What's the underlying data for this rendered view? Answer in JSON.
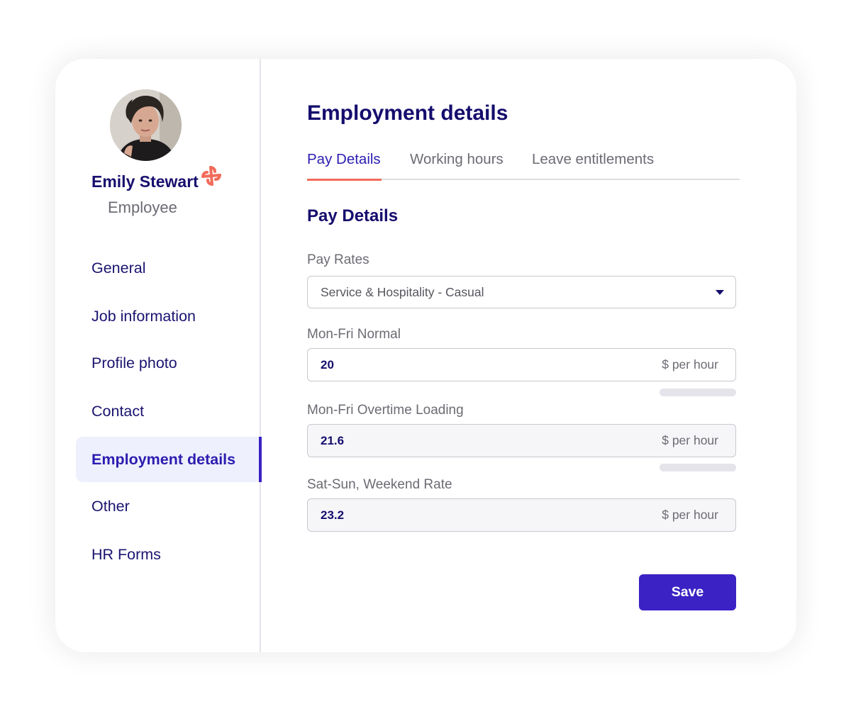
{
  "profile": {
    "name": "Emily Stewart",
    "role": "Employee",
    "avatar_icon": "person-photo"
  },
  "sidebar": {
    "items": [
      {
        "label": "General"
      },
      {
        "label": "Job information"
      },
      {
        "label": "Profile photo"
      },
      {
        "label": "Contact"
      },
      {
        "label": "Employment details",
        "active": true
      },
      {
        "label": "Other"
      },
      {
        "label": "HR Forms"
      }
    ]
  },
  "main": {
    "title": "Employment details",
    "tabs": [
      {
        "label": "Pay Details",
        "active": true
      },
      {
        "label": "Working hours"
      },
      {
        "label": "Leave entitlements"
      }
    ],
    "section_title": "Pay Details",
    "pay_rates": {
      "label": "Pay Rates",
      "value": "Service & Hospitality - Casual"
    },
    "fields": [
      {
        "label": "Mon-Fri Normal",
        "value": "20",
        "unit": "$ per hour"
      },
      {
        "label": "Mon-Fri Overtime Loading",
        "value": "21.6",
        "unit": "$ per hour"
      },
      {
        "label": "Sat-Sun, Weekend Rate",
        "value": "23.2",
        "unit": "$ per hour"
      }
    ],
    "save_label": "Save"
  },
  "colors": {
    "primary": "#3a22c4",
    "heading": "#150d6d",
    "accent": "#f26b5b",
    "active_nav_bg": "#eef0fd"
  }
}
